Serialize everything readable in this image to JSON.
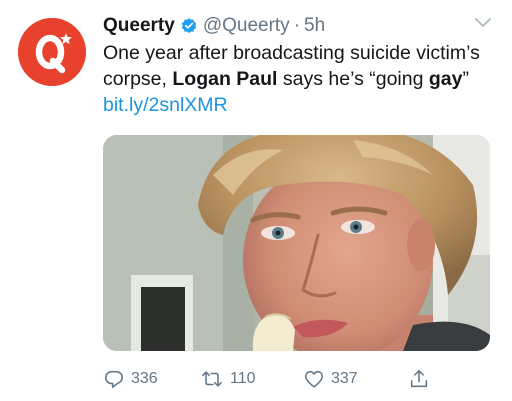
{
  "tweet": {
    "author": {
      "display_name": "Queerty",
      "handle": "@Queerty",
      "separator": "·",
      "time": "5h",
      "avatar_letter": "Q",
      "avatar_color": "#e8412e",
      "verified": true,
      "verified_color": "#1da1f2"
    },
    "text": {
      "part1": "One year after broadcasting suicide victim’s corpse, ",
      "bold1": "Logan Paul",
      "part2": " says he’s “going ",
      "bold2": "gay",
      "part3": "” ",
      "link": "bit.ly/2snlXMR",
      "link_color": "#1b95e0"
    },
    "actions": {
      "replies": "336",
      "retweets": "110",
      "likes": "337",
      "icons": [
        "reply-icon",
        "retweet-icon",
        "like-icon",
        "share-icon"
      ]
    }
  }
}
